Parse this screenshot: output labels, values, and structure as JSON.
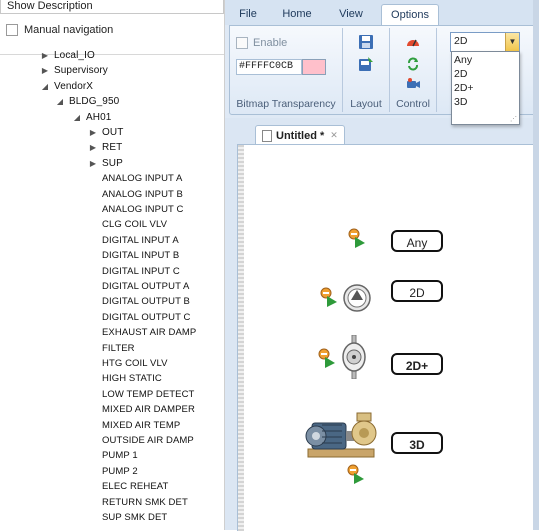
{
  "left_panel": {
    "show_description": "Show Description",
    "manual_navigation": "Manual navigation",
    "tree": [
      {
        "label": "Local_IO",
        "level": 1,
        "arrow": "collapsed"
      },
      {
        "label": "Supervisory",
        "level": 1,
        "arrow": "collapsed"
      },
      {
        "label": "VendorX",
        "level": 1,
        "arrow": "expanded"
      },
      {
        "label": "BLDG_950",
        "level": 2,
        "arrow": "expanded"
      },
      {
        "label": "AH01",
        "level": 3,
        "arrow": "expanded"
      },
      {
        "label": "OUT",
        "level": 4,
        "arrow": "collapsed"
      },
      {
        "label": "RET",
        "level": 4,
        "arrow": "collapsed"
      },
      {
        "label": "SUP",
        "level": 4,
        "arrow": "collapsed"
      },
      {
        "label": "ANALOG INPUT A",
        "level": 5,
        "arrow": ""
      },
      {
        "label": "ANALOG INPUT B",
        "level": 5,
        "arrow": ""
      },
      {
        "label": "ANALOG INPUT C",
        "level": 5,
        "arrow": ""
      },
      {
        "label": "CLG COIL VLV",
        "level": 5,
        "arrow": ""
      },
      {
        "label": "DIGITAL INPUT A",
        "level": 5,
        "arrow": ""
      },
      {
        "label": "DIGITAL INPUT B",
        "level": 5,
        "arrow": ""
      },
      {
        "label": "DIGITAL INPUT C",
        "level": 5,
        "arrow": ""
      },
      {
        "label": "DIGITAL OUTPUT A",
        "level": 5,
        "arrow": ""
      },
      {
        "label": "DIGITAL OUTPUT B",
        "level": 5,
        "arrow": ""
      },
      {
        "label": "DIGITAL OUTPUT C",
        "level": 5,
        "arrow": ""
      },
      {
        "label": "EXHAUST AIR DAMP",
        "level": 5,
        "arrow": ""
      },
      {
        "label": "FILTER",
        "level": 5,
        "arrow": ""
      },
      {
        "label": "HTG COIL VLV",
        "level": 5,
        "arrow": ""
      },
      {
        "label": "HIGH STATIC",
        "level": 5,
        "arrow": ""
      },
      {
        "label": "LOW TEMP DETECT",
        "level": 5,
        "arrow": ""
      },
      {
        "label": "MIXED AIR DAMPER",
        "level": 5,
        "arrow": ""
      },
      {
        "label": "MIXED AIR TEMP",
        "level": 5,
        "arrow": ""
      },
      {
        "label": "OUTSIDE AIR DAMP",
        "level": 5,
        "arrow": ""
      },
      {
        "label": "PUMP 1",
        "level": 5,
        "arrow": ""
      },
      {
        "label": "PUMP 2",
        "level": 5,
        "arrow": ""
      },
      {
        "label": "ELEC REHEAT",
        "level": 5,
        "arrow": ""
      },
      {
        "label": "RETURN SMK DET",
        "level": 5,
        "arrow": ""
      },
      {
        "label": "SUP SMK DET",
        "level": 5,
        "arrow": ""
      }
    ]
  },
  "ribbon": {
    "tabs": [
      {
        "label": "File",
        "active": false
      },
      {
        "label": "Home",
        "active": false
      },
      {
        "label": "View",
        "active": false
      },
      {
        "label": "Options",
        "active": true
      }
    ],
    "bitmap_transparency": {
      "enable_label": "Enable",
      "enabled": false,
      "color_value": "#FFFFC0CB",
      "swatch_color": "#ffc0cb",
      "group_label": "Bitmap Transparency"
    },
    "layout_group_label": "Layout",
    "control_group_label": "Control",
    "dimension": {
      "selected": "2D",
      "options": [
        "Any",
        "2D",
        "2D+",
        "3D"
      ]
    }
  },
  "document": {
    "tab_title": "Untitled *",
    "symbols": [
      {
        "label": "Any",
        "bold": false
      },
      {
        "label": "2D",
        "bold": false
      },
      {
        "label": "2D+",
        "bold": true
      },
      {
        "label": "3D",
        "bold": true
      }
    ]
  },
  "colors": {
    "ribbon_bg": "#dfe9f5",
    "accent_border": "#a9bfd6",
    "dropdown_arrow": "#f2c54b"
  }
}
